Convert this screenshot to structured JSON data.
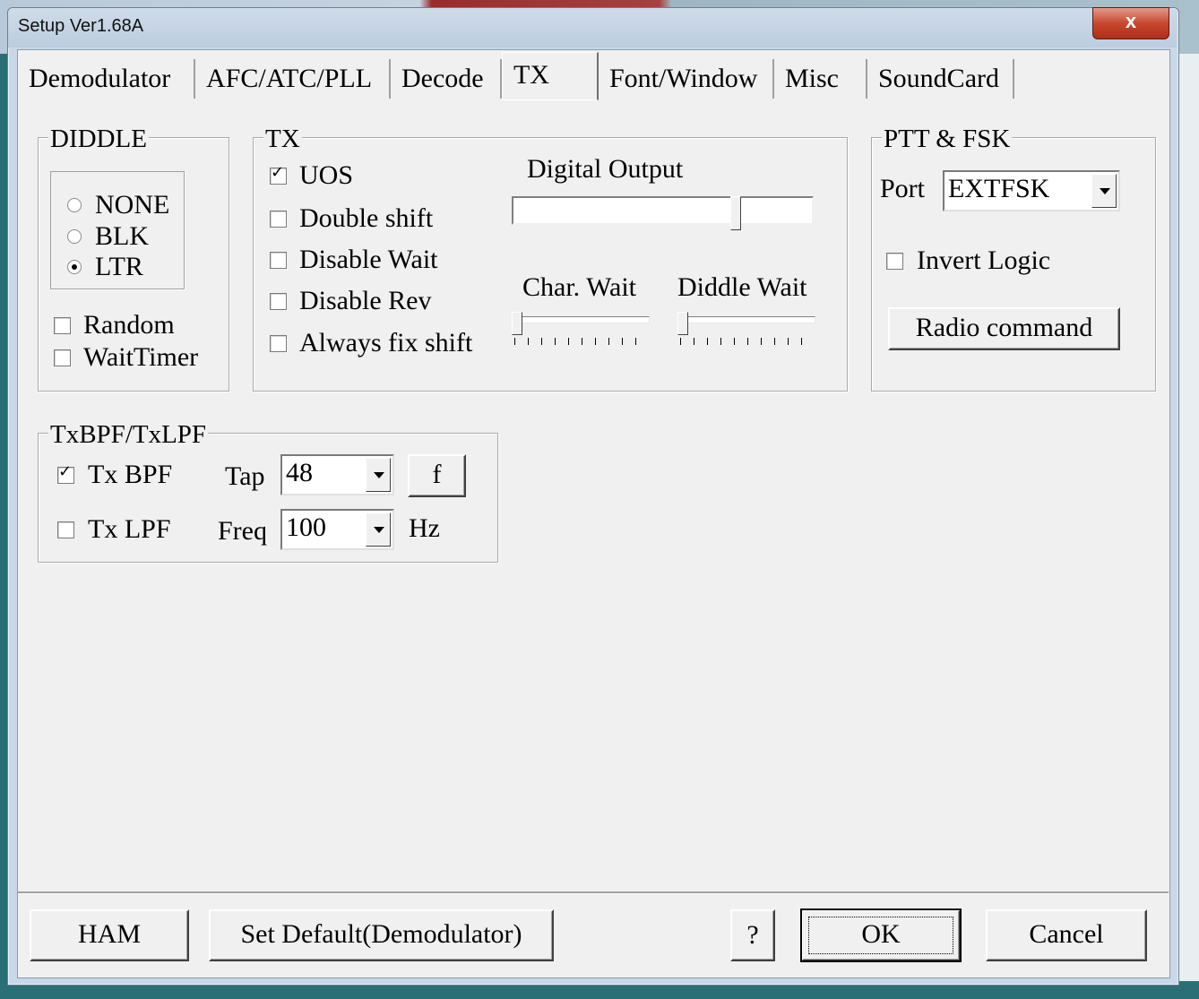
{
  "window": {
    "title": "Setup Ver1.68A",
    "close_glyph": "x"
  },
  "tabs": [
    {
      "label": "Demodulator"
    },
    {
      "label": "AFC/ATC/PLL"
    },
    {
      "label": "Decode"
    },
    {
      "label": "TX",
      "active": true
    },
    {
      "label": "Font/Window"
    },
    {
      "label": "Misc"
    },
    {
      "label": "SoundCard"
    }
  ],
  "diddle": {
    "title": "DIDDLE",
    "options": [
      {
        "label": "NONE",
        "selected": false
      },
      {
        "label": "BLK",
        "selected": false
      },
      {
        "label": "LTR",
        "selected": true
      }
    ],
    "random": {
      "label": "Random",
      "checked": false
    },
    "wait_timer": {
      "label": "WaitTimer",
      "checked": false
    }
  },
  "tx": {
    "title": "TX",
    "uos": {
      "label": "UOS",
      "checked": true
    },
    "double_shift": {
      "label": "Double shift",
      "checked": false
    },
    "disable_wait": {
      "label": "Disable Wait",
      "checked": false
    },
    "disable_rev": {
      "label": "Disable Rev",
      "checked": false
    },
    "always_fix_shift": {
      "label": "Always fix shift",
      "checked": false
    },
    "digital_output": {
      "label": "Digital Output",
      "level": 0.75
    },
    "char_wait": {
      "label": "Char. Wait",
      "level": 0.0
    },
    "diddle_wait": {
      "label": "Diddle Wait",
      "level": 0.0
    }
  },
  "ptt": {
    "title": "PTT & FSK",
    "port_label": "Port",
    "port_value": "EXTFSK",
    "invert_logic": {
      "label": "Invert Logic",
      "checked": false
    },
    "radio_command": "Radio command"
  },
  "txbpf": {
    "title": "TxBPF/TxLPF",
    "tx_bpf": {
      "label": "Tx BPF",
      "checked": true
    },
    "tx_lpf": {
      "label": "Tx LPF",
      "checked": false
    },
    "tap_label": "Tap",
    "tap_value": "48",
    "f_button": "f",
    "freq_label": "Freq",
    "freq_value": "100",
    "hz_label": "Hz"
  },
  "footer": {
    "ham": "HAM",
    "set_default": "Set Default(Demodulator)",
    "help": "?",
    "ok": "OK",
    "cancel": "Cancel"
  }
}
